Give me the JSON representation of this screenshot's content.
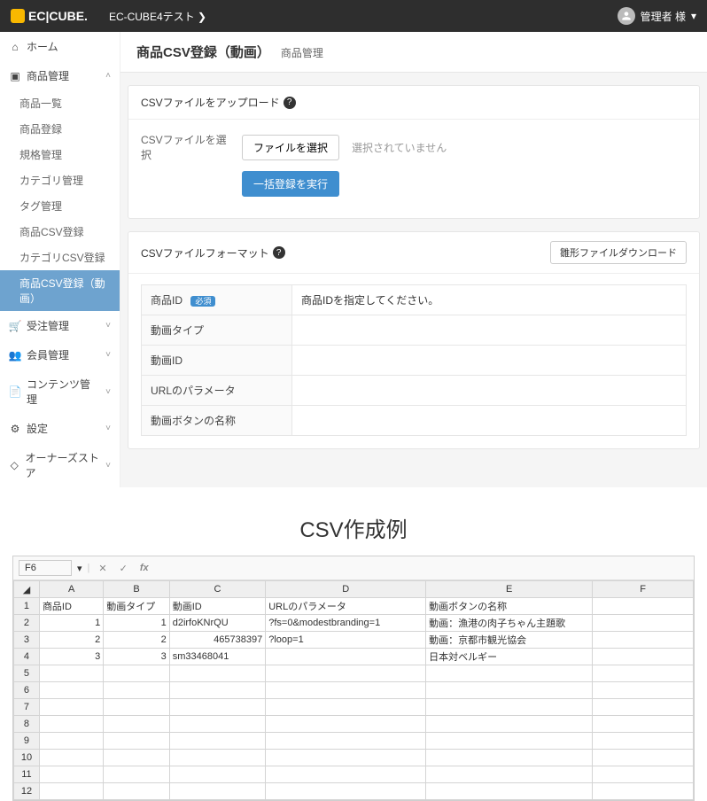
{
  "topnav": {
    "brand": "EC|CUBE.",
    "site": "EC-CUBE4テスト",
    "chevron": "❯",
    "user_label": "管理者 様",
    "user_chevron": "▾"
  },
  "sidebar": {
    "home": "ホーム",
    "product": "商品管理",
    "subs": [
      "商品一覧",
      "商品登録",
      "規格管理",
      "カテゴリ管理",
      "タグ管理",
      "商品CSV登録",
      "カテゴリCSV登録",
      "商品CSV登録（動画）"
    ],
    "order": "受注管理",
    "member": "会員管理",
    "contents": "コンテンツ管理",
    "settings": "設定",
    "owners": "オーナーズストア",
    "chev_open": "˄",
    "chev_close": "˅"
  },
  "page": {
    "title": "商品CSV登録（動画）",
    "sub": "商品管理"
  },
  "upload": {
    "head": "CSVファイルをアップロード",
    "select_label": "CSVファイルを選択",
    "file_btn": "ファイルを選択",
    "file_hint": "選択されていません",
    "exec_btn": "一括登録を実行"
  },
  "format": {
    "head": "CSVファイルフォーマット",
    "dl": "雛形ファイルダウンロード",
    "required_badge": "必須",
    "rows": [
      {
        "k": "商品ID",
        "v": "商品IDを指定してください。",
        "req": true
      },
      {
        "k": "動画タイプ",
        "v": ""
      },
      {
        "k": "動画ID",
        "v": ""
      },
      {
        "k": "URLのパラメータ",
        "v": ""
      },
      {
        "k": "動画ボタンの名称",
        "v": ""
      }
    ]
  },
  "example": {
    "title": "CSV作成例"
  },
  "sheet": {
    "toolbar": {
      "cellref": "F6",
      "dd": "▾",
      "cancel": "✕",
      "accept": "✓",
      "fx": "fx"
    },
    "cols": [
      "A",
      "B",
      "C",
      "D",
      "E",
      "F"
    ],
    "header": [
      "商品ID",
      "動画タイプ",
      "動画ID",
      "URLのパラメータ",
      "動画ボタンの名称",
      ""
    ],
    "rows": [
      [
        "1",
        "1",
        "d2irfoKNrQU",
        "?fs=0&modestbranding=1",
        "動画：漁港の肉子ちゃん主題歌",
        ""
      ],
      [
        "2",
        "2",
        "465738397",
        "?loop=1",
        "動画：京都市観光協会",
        ""
      ],
      [
        "3",
        "3",
        "sm33468041",
        "",
        "日本対ベルギー",
        ""
      ],
      [
        "",
        "",
        "",
        "",
        "",
        ""
      ],
      [
        "",
        "",
        "",
        "",
        "",
        ""
      ],
      [
        "",
        "",
        "",
        "",
        "",
        ""
      ],
      [
        "",
        "",
        "",
        "",
        "",
        ""
      ],
      [
        "",
        "",
        "",
        "",
        "",
        ""
      ],
      [
        "",
        "",
        "",
        "",
        "",
        ""
      ],
      [
        "",
        "",
        "",
        "",
        "",
        ""
      ],
      [
        "",
        "",
        "",
        "",
        "",
        ""
      ]
    ]
  }
}
